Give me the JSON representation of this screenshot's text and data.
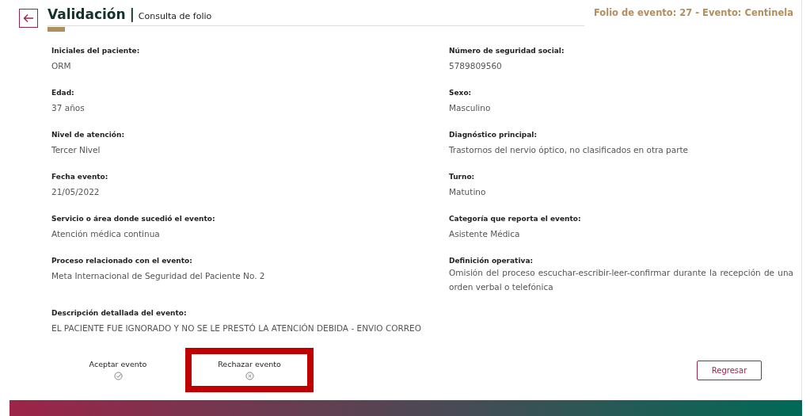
{
  "header": {
    "title": "Validación",
    "separator": "|",
    "subtitle": "Consulta de folio",
    "folio": "Folio de evento: 27 - Evento: Centinela"
  },
  "fields": [
    {
      "label": "Iniciales del paciente:",
      "value": "ORM"
    },
    {
      "label": "Número de seguridad social:",
      "value": "5789809560"
    },
    {
      "label": "Edad:",
      "value": "37 años"
    },
    {
      "label": "Sexo:",
      "value": "Masculino"
    },
    {
      "label": "Nivel de atención:",
      "value": "Tercer Nivel"
    },
    {
      "label": "Diagnóstico principal:",
      "value": "Trastornos del nervio óptico, no clasificados en otra parte"
    },
    {
      "label": "Fecha evento:",
      "value": "21/05/2022"
    },
    {
      "label": "Turno:",
      "value": "Matutino"
    },
    {
      "label": "Servicio o área donde sucedió el evento:",
      "value": "Atención médica continua"
    },
    {
      "label": "Categoría que reporta el evento:",
      "value": "Asistente Médica"
    },
    {
      "label": "Proceso relacionado con el evento:",
      "value": "Meta Internacional de Seguridad del Paciente No. 2"
    },
    {
      "label": "Definición operativa:",
      "value": "Omisión del proceso escuchar-escribir-leer-confirmar durante la recepción de una orden verbal o telefónica"
    }
  ],
  "description": {
    "label": "Descripción detallada del evento:",
    "value": "EL PACIENTE FUE IGNORADO Y NO SE LE PRESTÓ LA ATENCIÓN DEBIDA - ENVIO CORREO"
  },
  "actions": [
    {
      "kind": "accept",
      "label": "Aceptar evento",
      "highlighted": false
    },
    {
      "kind": "reject",
      "label": "Rechazar evento",
      "highlighted": true
    }
  ],
  "back_button": "Regresar"
}
